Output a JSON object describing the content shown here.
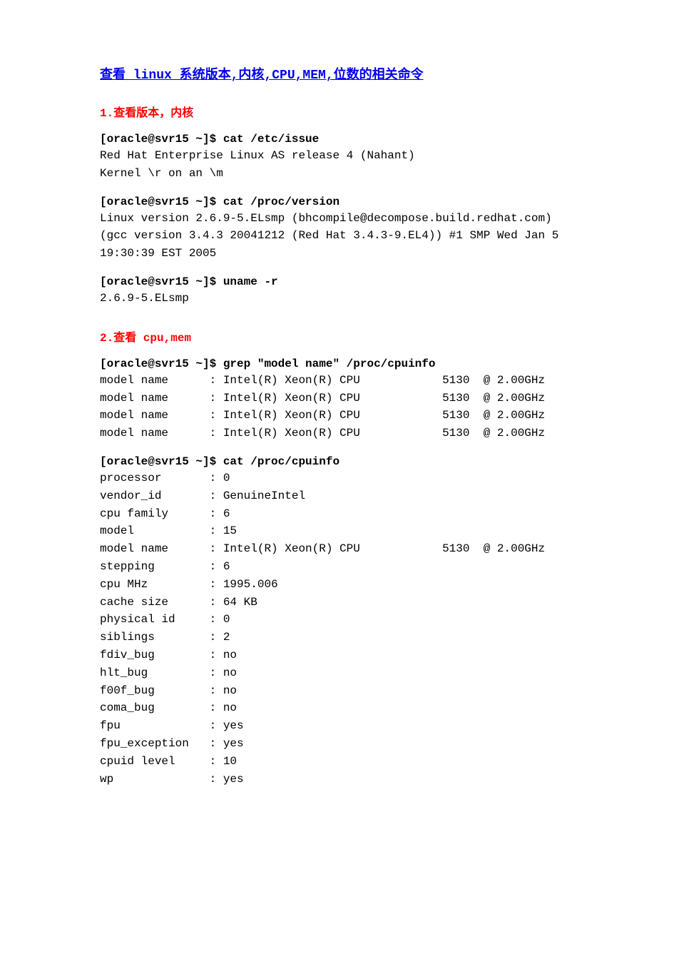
{
  "title": "查看 linux 系统版本,内核,CPU,MEM,位数的相关命令",
  "section1": {
    "heading": "1.查看版本，内核",
    "cmd1": "[oracle@svr15 ~]$ cat /etc/issue",
    "out1": "Red Hat Enterprise Linux AS release 4 (Nahant)\nKernel \\r on an \\m",
    "cmd2": "[oracle@svr15 ~]$ cat /proc/version",
    "out2": "Linux version 2.6.9-5.ELsmp (bhcompile@decompose.build.redhat.com) (gcc version 3.4.3 20041212 (Red Hat 3.4.3-9.EL4)) #1 SMP Wed Jan 5 19:30:39 EST 2005",
    "cmd3": "[oracle@svr15 ~]$ uname -r",
    "out3": "2.6.9-5.ELsmp"
  },
  "section2": {
    "heading": "2.查看 cpu,mem",
    "cmd1": "[oracle@svr15 ~]$  grep \"model name\" /proc/cpuinfo",
    "out1": "model name      : Intel(R) Xeon(R) CPU            5130  @ 2.00GHz\nmodel name      : Intel(R) Xeon(R) CPU            5130  @ 2.00GHz\nmodel name      : Intel(R) Xeon(R) CPU            5130  @ 2.00GHz\nmodel name      : Intel(R) Xeon(R) CPU            5130  @ 2.00GHz",
    "cmd2": "[oracle@svr15 ~]$ cat /proc/cpuinfo",
    "out2": "processor       : 0\nvendor_id       : GenuineIntel\ncpu family      : 6\nmodel           : 15\nmodel name      : Intel(R) Xeon(R) CPU            5130  @ 2.00GHz\nstepping        : 6\ncpu MHz         : 1995.006\ncache size      : 64 KB\nphysical id     : 0\nsiblings        : 2\nfdiv_bug        : no\nhlt_bug         : no\nf00f_bug        : no\ncoma_bug        : no\nfpu             : yes\nfpu_exception   : yes\ncpuid level     : 10\nwp              : yes"
  }
}
